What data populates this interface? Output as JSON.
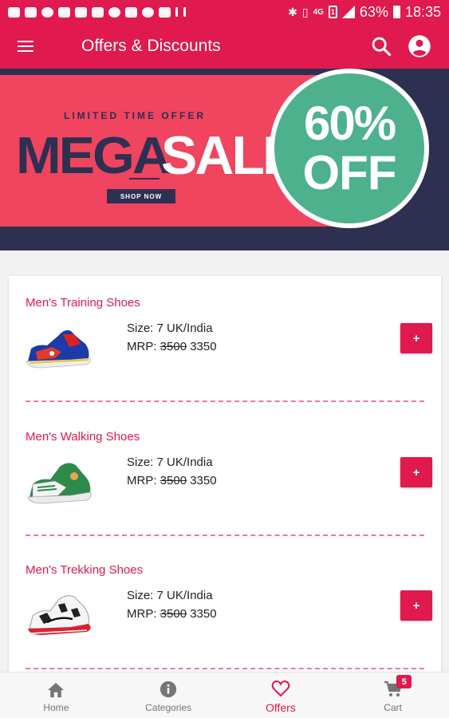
{
  "status_bar": {
    "network": "4G",
    "sim": "1",
    "battery": "63%",
    "time": "18:35"
  },
  "app_bar": {
    "title": "Offers & Discounts",
    "icons": [
      "menu-icon",
      "search-icon",
      "account-icon"
    ]
  },
  "banner": {
    "kicker": "LIMITED TIME OFFER",
    "headline_part1": "MEGA",
    "headline_part2": "SALE",
    "cta": "SHOP NOW",
    "discount_top": "60%",
    "discount_bottom": "OFF"
  },
  "products": [
    {
      "title": "Men's Training Shoes",
      "size": "Size: 7 UK/India",
      "mrp_label": "MRP: ",
      "old_price": "3500",
      "price": "3350",
      "add_label": "+"
    },
    {
      "title": "Men's Walking Shoes",
      "size": "Size: 7 UK/India",
      "mrp_label": "MRP: ",
      "old_price": "3500",
      "price": "3350",
      "add_label": "+"
    },
    {
      "title": "Men's Trekking Shoes",
      "size": "Size: 7 UK/India",
      "mrp_label": "MRP: ",
      "old_price": "3500",
      "price": "3350",
      "add_label": "+"
    }
  ],
  "bottom_nav": {
    "items": [
      {
        "label": "Home",
        "icon": "home-icon"
      },
      {
        "label": "Categories",
        "icon": "info-icon"
      },
      {
        "label": "Offers",
        "icon": "heart-icon"
      },
      {
        "label": "Cart",
        "icon": "cart-icon"
      }
    ],
    "active": "Offers",
    "cart_badge": "5"
  },
  "colors": {
    "primary": "#e0194e",
    "banner_navy": "#2e3052",
    "banner_red": "#f0445f",
    "badge_green": "#4db18d",
    "inactive_gray": "#757575"
  }
}
